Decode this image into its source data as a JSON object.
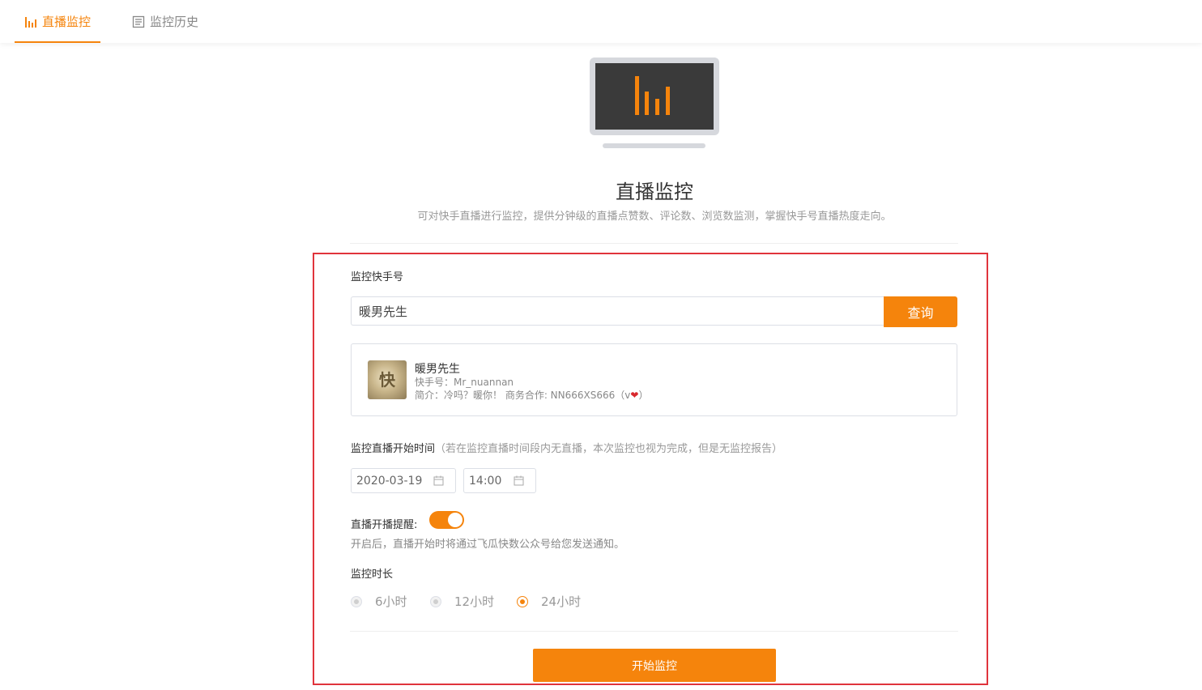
{
  "tabs": [
    {
      "label": "直播监控",
      "icon": "bar-chart-icon",
      "active": true
    },
    {
      "label": "监控历史",
      "icon": "document-icon",
      "active": false
    }
  ],
  "hero": {
    "icon": "monitor-chart-icon",
    "title": "直播监控",
    "subtitle": "可对快手直播进行监控，提供分钟级的直播点赞数、评论数、浏览数监测，掌握快手号直播热度走向。"
  },
  "form": {
    "account_label": "监控快手号",
    "search_value": "暖男先生",
    "query_button": "查询",
    "user": {
      "name": "暖男先生",
      "kuaishou_id": "快手号：Mr_nuannan",
      "bio_prefix": "简介：冷吗？暖你！ 商务合作: NN666XS666（v",
      "bio_heart": "❤",
      "bio_suffix": "）"
    },
    "start_time_label": "监控直播开始时间",
    "start_time_note": "（若在监控直播时间段内无直播，本次监控也视为完成，但是无监控报告）",
    "date_value": "2020-03-19",
    "time_value": "14:00",
    "reminder_label": "直播开播提醒:",
    "reminder_on": true,
    "reminder_hint": "开启后，直播开始时将通过飞瓜快数公众号给您发送通知。",
    "duration_label": "监控时长",
    "duration_options": [
      "6小时",
      "12小时",
      "24小时"
    ],
    "duration_selected": "24小时",
    "submit_button": "开始监控"
  },
  "colors": {
    "accent": "#f5840c",
    "highlight_frame": "#e0343c"
  }
}
